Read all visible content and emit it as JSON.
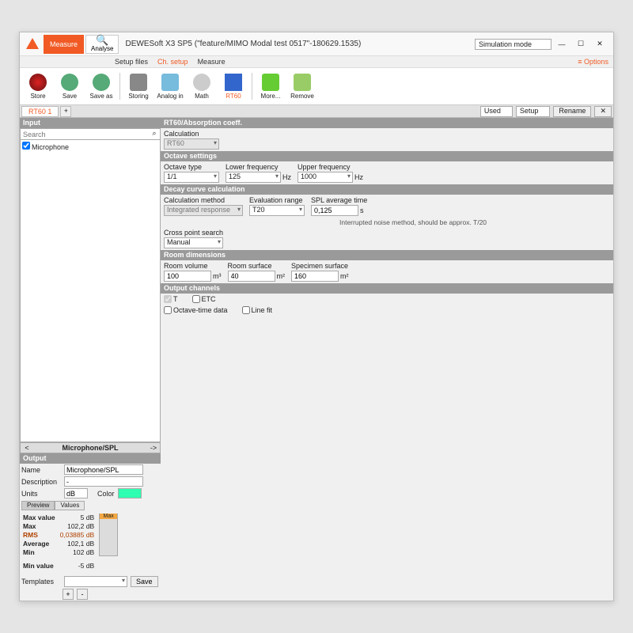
{
  "titlebar": {
    "app_title": "DEWESoft X3 SP5 (\"feature/MIMO Modal test 0517\"-180629.1535)",
    "measure": "Measure",
    "analyse": "Analyse",
    "sim_mode": "Simulation mode",
    "options": "Options"
  },
  "menubar": {
    "items": [
      "Setup files",
      "Ch. setup",
      "Measure"
    ],
    "active_index": 1
  },
  "toolbar": {
    "items": [
      "Store",
      "Save",
      "Save as",
      "Storing",
      "Analog in",
      "Math",
      "RT60",
      "More...",
      "Remove"
    ],
    "active_index": 6
  },
  "tabrow": {
    "tab": "RT60 1",
    "used": "Used",
    "setup": "Setup",
    "rename": "Rename"
  },
  "input": {
    "header": "Input",
    "search_placeholder": "Search",
    "item": "Microphone",
    "checked": true
  },
  "nav": {
    "label": "Microphone/SPL"
  },
  "output": {
    "header": "Output",
    "name_lbl": "Name",
    "name_val": "Microphone/SPL",
    "desc_lbl": "Description",
    "desc_val": "-",
    "units_lbl": "Units",
    "units_val": "dB",
    "color_lbl": "Color",
    "tabs": [
      "Preview",
      "Values"
    ],
    "maxvalue_lbl": "Max value",
    "maxvalue": "5 dB",
    "max_lbl": "Max",
    "max": "102,2 dB",
    "rms_lbl": "RMS",
    "rms": "0,03885 dB",
    "avg_lbl": "Average",
    "avg": "102,1 dB",
    "min_lbl": "Min",
    "min": "102 dB",
    "minvalue_lbl": "Min value",
    "minvalue": "-5 dB",
    "meter_top": "Max",
    "templates_lbl": "Templates",
    "save_btn": "Save"
  },
  "rt60": {
    "hdr": "RT60/Absorption coeff.",
    "calc_lbl": "Calculation",
    "calc_val": "RT60"
  },
  "octave": {
    "hdr": "Octave settings",
    "type_lbl": "Octave type",
    "type_val": "1/1",
    "low_lbl": "Lower frequency",
    "low_val": "125",
    "low_unit": "Hz",
    "up_lbl": "Upper frequency",
    "up_val": "1000",
    "up_unit": "Hz"
  },
  "decay": {
    "hdr": "Decay curve calculation",
    "method_lbl": "Calculation method",
    "method_val": "Integrated response",
    "eval_lbl": "Evaluation range",
    "eval_val": "T20",
    "spl_lbl": "SPL average time",
    "spl_val": "0,125",
    "spl_unit": "s",
    "cross_lbl": "Cross point search",
    "cross_val": "Manual",
    "note": "Interrupted noise method, should be approx. T/20"
  },
  "room": {
    "hdr": "Room dimensions",
    "vol_lbl": "Room volume",
    "vol_val": "100",
    "vol_unit": "m³",
    "surf_lbl": "Room surface",
    "surf_val": "40",
    "surf_unit": "m²",
    "spec_lbl": "Specimen surface",
    "spec_val": "160",
    "spec_unit": "m²"
  },
  "outchan": {
    "hdr": "Output channels",
    "t": "T",
    "etc": "ETC",
    "oct": "Octave-time data",
    "line": "Line fit"
  }
}
